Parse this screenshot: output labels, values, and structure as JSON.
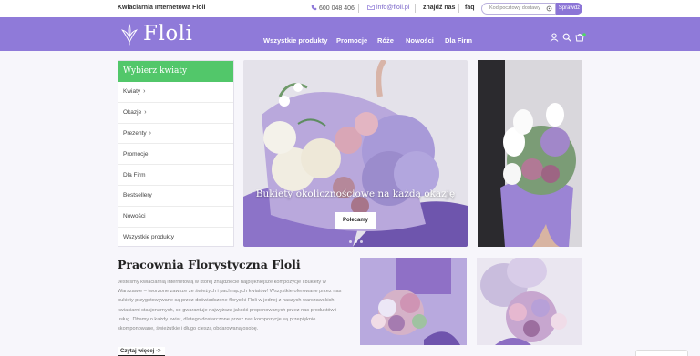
{
  "topbar": {
    "shop_name": "Kwiaciarnia Internetowa Floli",
    "phone": "600 048 406",
    "email": "info@floli.pl",
    "find_us": "znajdź nas",
    "faq": "faq",
    "zip_placeholder": "Kod pocztowy dostawy",
    "zip_button": "Sprawdź"
  },
  "header": {
    "logo_text": "Floli",
    "menu": [
      "Wszystkie produkty",
      "Promocje",
      "Róże",
      "Nowości",
      "Dla Firm"
    ],
    "icons": [
      "user-icon",
      "search-icon",
      "cart-icon"
    ]
  },
  "categories": {
    "heading": "Wybierz kwiaty",
    "items": [
      {
        "label": "Kwiaty",
        "has_submenu": true
      },
      {
        "label": "Okazje",
        "has_submenu": true
      },
      {
        "label": "Prezenty",
        "has_submenu": true
      },
      {
        "label": "Promocje",
        "has_submenu": false
      },
      {
        "label": "Dla Firm",
        "has_submenu": false
      },
      {
        "label": "Bestsellery",
        "has_submenu": false
      },
      {
        "label": "Nowości",
        "has_submenu": false
      },
      {
        "label": "Wszystkie produkty",
        "has_submenu": false
      }
    ]
  },
  "hero": {
    "caption": "Bukiety okolicznościowe na każdą okazję",
    "cta": "Polecamy"
  },
  "about": {
    "title": "Pracownia Florystyczna Floli",
    "text": "Jesteśmy kwiaciarnią internetową w której znajdziecie najpiękniejsze kompozycje i bukiety w Warszawie – tworzone zawsze ze świeżych i pachnących kwiatów! Wszystkie oferowane przez nas bukiety przygotowywane są przez doświadczone florystki Floli w jednej z naszych warszawskich kwiaciarni stacjonarnych, co gwarantuje najwyższą jakość proponowanych przez nas produktów i usług. Dbamy o każdy kwiat, dlatego dostarczone przez nas kompozycje są przepięknie skomponowane, świeżutkie i długo cieszą obdarowaną osobę.",
    "read_more": "Czytaj więcej ->"
  },
  "colors": {
    "brand_purple": "#8f7ad9",
    "category_green": "#52c76a",
    "cart_dot": "#4cd964"
  }
}
